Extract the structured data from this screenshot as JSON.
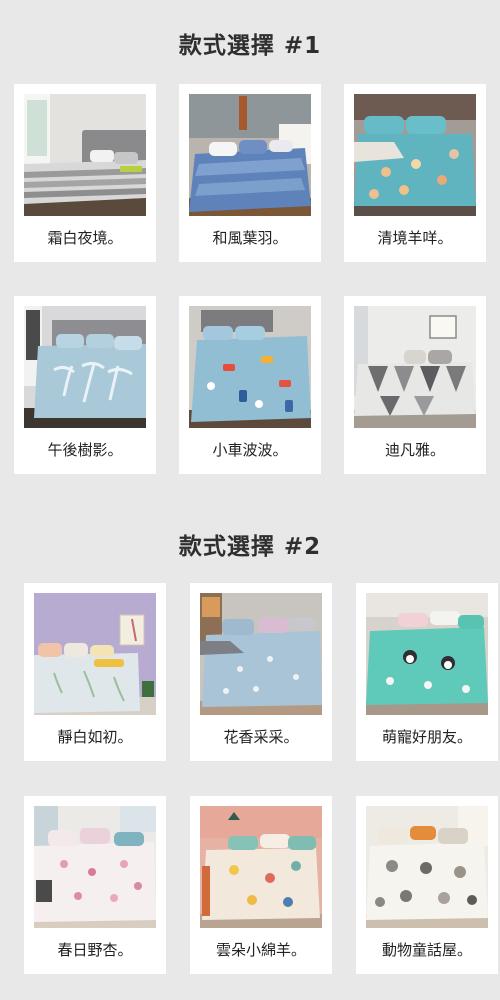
{
  "sections": [
    {
      "title": "款式選擇 #1",
      "items": [
        {
          "label": "霜白夜境。",
          "theme": "gray-stripe"
        },
        {
          "label": "和風葉羽。",
          "theme": "blue-leaf"
        },
        {
          "label": "清境羊咩。",
          "theme": "teal-sheep"
        },
        {
          "label": "午後樹影。",
          "theme": "light-blue-palm"
        },
        {
          "label": "小車波波。",
          "theme": "blue-cars"
        },
        {
          "label": "迪凡雅。",
          "theme": "gray-geometric"
        }
      ]
    },
    {
      "title": "款式選擇 #2",
      "items": [
        {
          "label": "靜白如初。",
          "theme": "white-floral-purple-wall"
        },
        {
          "label": "花香采采。",
          "theme": "light-blue-floral"
        },
        {
          "label": "萌寵好朋友。",
          "theme": "mint-pets"
        },
        {
          "label": "春日野杏。",
          "theme": "pink-blossom"
        },
        {
          "label": "雲朵小綿羊。",
          "theme": "cream-sheep-orange-wall"
        },
        {
          "label": "動物童話屋。",
          "theme": "white-animals"
        }
      ]
    }
  ]
}
